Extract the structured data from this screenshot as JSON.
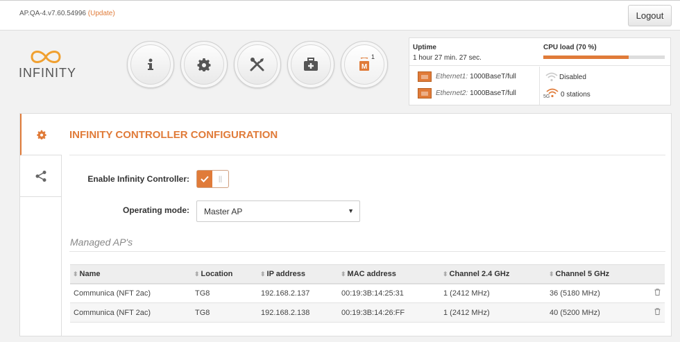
{
  "header": {
    "version": "AP.QA-4.v7.60.54996",
    "update_link": "(Update)",
    "logout_label": "Logout"
  },
  "logo": {
    "text": "INFINITY"
  },
  "nav": {
    "buttons": [
      {
        "name": "info",
        "icon": "info-icon"
      },
      {
        "name": "settings",
        "icon": "gear-icon"
      },
      {
        "name": "tools",
        "icon": "tools-icon"
      },
      {
        "name": "toolbox",
        "icon": "medkit-icon"
      },
      {
        "name": "controller",
        "icon": "controller-m-icon",
        "badge_letter": "M",
        "badge": "1"
      }
    ]
  },
  "status": {
    "uptime_label": "Uptime",
    "uptime_value": "1 hour 27 min. 27 sec.",
    "cpu_label": "CPU load (70 %)",
    "cpu_load": 0.7,
    "eth1_name": "Ethernet1:",
    "eth1_value": "1000BaseT/full",
    "eth2_name": "Ethernet2:",
    "eth2_value": "1000BaseT/full",
    "wifi24_value": "Disabled",
    "wifi5_tag": "5G",
    "wifi5_value": "0 stations"
  },
  "colors": {
    "accent": "#e07b39"
  },
  "panel": {
    "title": "INFINITY CONTROLLER CONFIGURATION",
    "enable_label": "Enable Infinity Controller:",
    "enable_checked": true,
    "mode_label": "Operating mode:",
    "mode_value": "Master AP",
    "managed_title": "Managed AP's"
  },
  "table": {
    "headers": [
      "Name",
      "Location",
      "IP address",
      "MAC address",
      "Channel 2.4 GHz",
      "Channel 5 GHz"
    ],
    "rows": [
      [
        "Communica (NFT 2ac)",
        "TG8",
        "192.168.2.137",
        "00:19:3B:14:25:31",
        "1 (2412 MHz)",
        "36 (5180 MHz)"
      ],
      [
        "Communica (NFT 2ac)",
        "TG8",
        "192.168.2.138",
        "00:19:3B:14:26:FF",
        "1 (2412 MHz)",
        "40 (5200 MHz)"
      ]
    ]
  }
}
